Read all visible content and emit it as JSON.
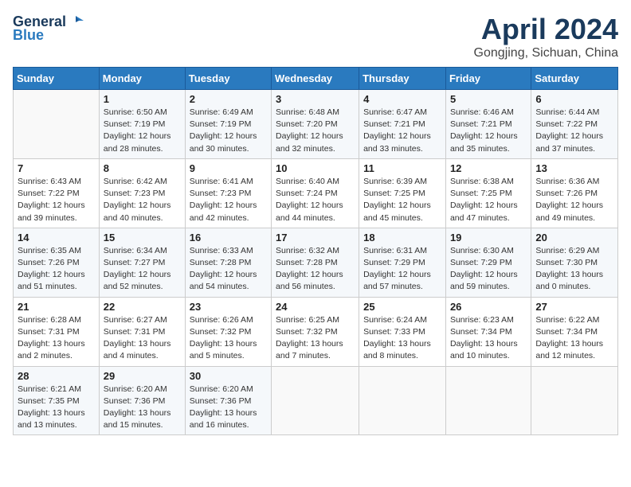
{
  "header": {
    "logo_line1": "General",
    "logo_line2": "Blue",
    "month": "April 2024",
    "location": "Gongjing, Sichuan, China"
  },
  "columns": [
    "Sunday",
    "Monday",
    "Tuesday",
    "Wednesday",
    "Thursday",
    "Friday",
    "Saturday"
  ],
  "weeks": [
    [
      {
        "day": "",
        "detail": ""
      },
      {
        "day": "1",
        "detail": "Sunrise: 6:50 AM\nSunset: 7:19 PM\nDaylight: 12 hours\nand 28 minutes."
      },
      {
        "day": "2",
        "detail": "Sunrise: 6:49 AM\nSunset: 7:19 PM\nDaylight: 12 hours\nand 30 minutes."
      },
      {
        "day": "3",
        "detail": "Sunrise: 6:48 AM\nSunset: 7:20 PM\nDaylight: 12 hours\nand 32 minutes."
      },
      {
        "day": "4",
        "detail": "Sunrise: 6:47 AM\nSunset: 7:21 PM\nDaylight: 12 hours\nand 33 minutes."
      },
      {
        "day": "5",
        "detail": "Sunrise: 6:46 AM\nSunset: 7:21 PM\nDaylight: 12 hours\nand 35 minutes."
      },
      {
        "day": "6",
        "detail": "Sunrise: 6:44 AM\nSunset: 7:22 PM\nDaylight: 12 hours\nand 37 minutes."
      }
    ],
    [
      {
        "day": "7",
        "detail": "Sunrise: 6:43 AM\nSunset: 7:22 PM\nDaylight: 12 hours\nand 39 minutes."
      },
      {
        "day": "8",
        "detail": "Sunrise: 6:42 AM\nSunset: 7:23 PM\nDaylight: 12 hours\nand 40 minutes."
      },
      {
        "day": "9",
        "detail": "Sunrise: 6:41 AM\nSunset: 7:23 PM\nDaylight: 12 hours\nand 42 minutes."
      },
      {
        "day": "10",
        "detail": "Sunrise: 6:40 AM\nSunset: 7:24 PM\nDaylight: 12 hours\nand 44 minutes."
      },
      {
        "day": "11",
        "detail": "Sunrise: 6:39 AM\nSunset: 7:25 PM\nDaylight: 12 hours\nand 45 minutes."
      },
      {
        "day": "12",
        "detail": "Sunrise: 6:38 AM\nSunset: 7:25 PM\nDaylight: 12 hours\nand 47 minutes."
      },
      {
        "day": "13",
        "detail": "Sunrise: 6:36 AM\nSunset: 7:26 PM\nDaylight: 12 hours\nand 49 minutes."
      }
    ],
    [
      {
        "day": "14",
        "detail": "Sunrise: 6:35 AM\nSunset: 7:26 PM\nDaylight: 12 hours\nand 51 minutes."
      },
      {
        "day": "15",
        "detail": "Sunrise: 6:34 AM\nSunset: 7:27 PM\nDaylight: 12 hours\nand 52 minutes."
      },
      {
        "day": "16",
        "detail": "Sunrise: 6:33 AM\nSunset: 7:28 PM\nDaylight: 12 hours\nand 54 minutes."
      },
      {
        "day": "17",
        "detail": "Sunrise: 6:32 AM\nSunset: 7:28 PM\nDaylight: 12 hours\nand 56 minutes."
      },
      {
        "day": "18",
        "detail": "Sunrise: 6:31 AM\nSunset: 7:29 PM\nDaylight: 12 hours\nand 57 minutes."
      },
      {
        "day": "19",
        "detail": "Sunrise: 6:30 AM\nSunset: 7:29 PM\nDaylight: 12 hours\nand 59 minutes."
      },
      {
        "day": "20",
        "detail": "Sunrise: 6:29 AM\nSunset: 7:30 PM\nDaylight: 13 hours\nand 0 minutes."
      }
    ],
    [
      {
        "day": "21",
        "detail": "Sunrise: 6:28 AM\nSunset: 7:31 PM\nDaylight: 13 hours\nand 2 minutes."
      },
      {
        "day": "22",
        "detail": "Sunrise: 6:27 AM\nSunset: 7:31 PM\nDaylight: 13 hours\nand 4 minutes."
      },
      {
        "day": "23",
        "detail": "Sunrise: 6:26 AM\nSunset: 7:32 PM\nDaylight: 13 hours\nand 5 minutes."
      },
      {
        "day": "24",
        "detail": "Sunrise: 6:25 AM\nSunset: 7:32 PM\nDaylight: 13 hours\nand 7 minutes."
      },
      {
        "day": "25",
        "detail": "Sunrise: 6:24 AM\nSunset: 7:33 PM\nDaylight: 13 hours\nand 8 minutes."
      },
      {
        "day": "26",
        "detail": "Sunrise: 6:23 AM\nSunset: 7:34 PM\nDaylight: 13 hours\nand 10 minutes."
      },
      {
        "day": "27",
        "detail": "Sunrise: 6:22 AM\nSunset: 7:34 PM\nDaylight: 13 hours\nand 12 minutes."
      }
    ],
    [
      {
        "day": "28",
        "detail": "Sunrise: 6:21 AM\nSunset: 7:35 PM\nDaylight: 13 hours\nand 13 minutes."
      },
      {
        "day": "29",
        "detail": "Sunrise: 6:20 AM\nSunset: 7:36 PM\nDaylight: 13 hours\nand 15 minutes."
      },
      {
        "day": "30",
        "detail": "Sunrise: 6:20 AM\nSunset: 7:36 PM\nDaylight: 13 hours\nand 16 minutes."
      },
      {
        "day": "",
        "detail": ""
      },
      {
        "day": "",
        "detail": ""
      },
      {
        "day": "",
        "detail": ""
      },
      {
        "day": "",
        "detail": ""
      }
    ]
  ]
}
